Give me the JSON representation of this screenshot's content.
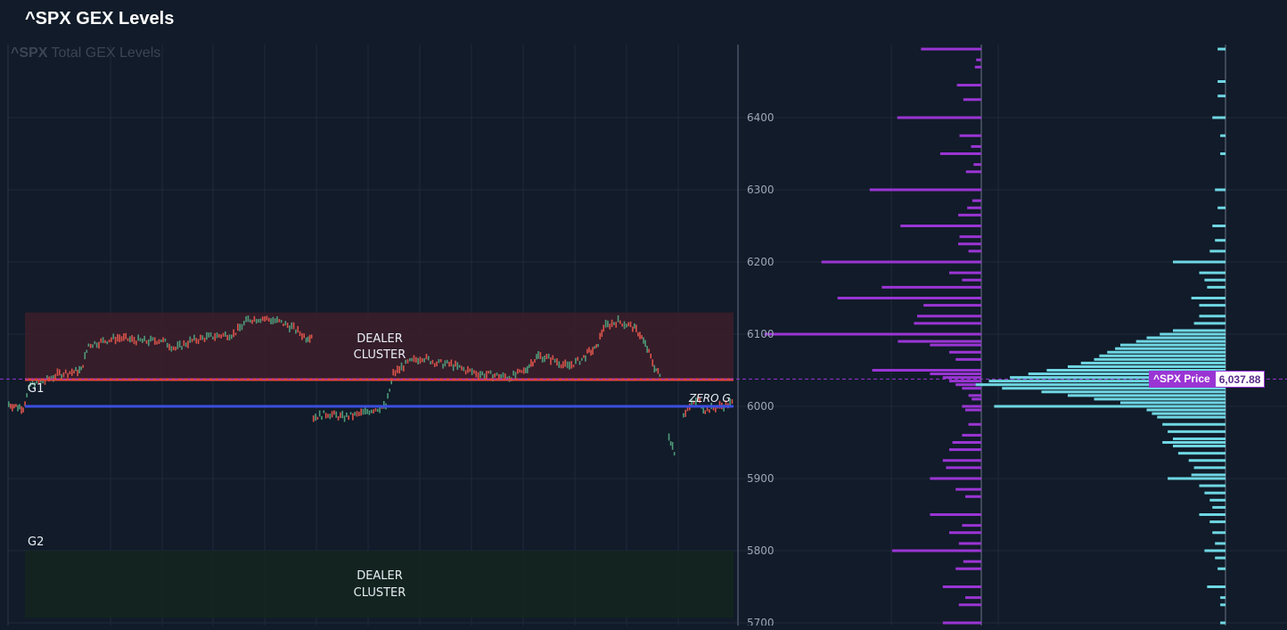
{
  "header": {
    "title": "^SPX GEX Levels"
  },
  "chart_title": {
    "ticker": "^SPX",
    "rest": "Total GEX Levels"
  },
  "colors": {
    "background": "#111b29",
    "grid": "#1f2a3a",
    "resistance_zone": "#3a1e2a",
    "support_zone": "#14261f",
    "g1_line": "#e2463c",
    "zero_gamma_line": "#3b4ee0",
    "candle_up": "#4e9a79",
    "candle_down": "#d9534a",
    "negative_gex": "#9a35d4",
    "positive_gex": "#6fd7e3",
    "price_marker": "#9a35d4"
  },
  "labels": {
    "g1": "G1",
    "g2": "G2",
    "zero_gamma": "ZERO G",
    "upper_cluster_line1": "DEALER",
    "upper_cluster_line2": "CLUSTER",
    "lower_cluster_line1": "DEALER",
    "lower_cluster_line2": "CLUSTER",
    "price_label": "^SPX Price",
    "price_value": "6,037.88"
  },
  "chart_data": {
    "type": "bar",
    "title": "^SPX Total GEX Levels",
    "ylim": [
      5700,
      6500
    ],
    "y_ticks": [
      5700,
      5800,
      5900,
      6000,
      6100,
      6200,
      6300,
      6400
    ],
    "levels": {
      "g1": 6037,
      "zero_gamma": 6000,
      "current_price": 6037.88
    },
    "zones": [
      {
        "name": "upper dealer cluster",
        "from": 6037,
        "to": 6130
      },
      {
        "name": "lower dealer cluster",
        "from": 5707,
        "to": 5800
      }
    ],
    "price_path": [
      [
        0.0,
        6003
      ],
      [
        0.01,
        6000
      ],
      [
        0.02,
        5998
      ],
      [
        0.03,
        6030
      ],
      [
        0.05,
        6035
      ],
      [
        0.07,
        6045
      ],
      [
        0.09,
        6048
      ],
      [
        0.1,
        6050
      ],
      [
        0.11,
        6085
      ],
      [
        0.13,
        6090
      ],
      [
        0.15,
        6095
      ],
      [
        0.17,
        6092
      ],
      [
        0.19,
        6090
      ],
      [
        0.21,
        6092
      ],
      [
        0.23,
        6080
      ],
      [
        0.25,
        6090
      ],
      [
        0.27,
        6095
      ],
      [
        0.29,
        6098
      ],
      [
        0.31,
        6100
      ],
      [
        0.33,
        6120
      ],
      [
        0.35,
        6122
      ],
      [
        0.37,
        6118
      ],
      [
        0.39,
        6110
      ],
      [
        0.41,
        6095
      ],
      [
        0.42,
        6100
      ],
      [
        null,
        null
      ],
      [
        0.42,
        5985
      ],
      [
        0.44,
        5990
      ],
      [
        0.46,
        5985
      ],
      [
        0.48,
        5988
      ],
      [
        0.5,
        5995
      ],
      [
        0.52,
        6000
      ],
      [
        0.53,
        6045
      ],
      [
        0.55,
        6060
      ],
      [
        0.57,
        6068
      ],
      [
        0.59,
        6060
      ],
      [
        0.61,
        6058
      ],
      [
        0.63,
        6050
      ],
      [
        0.65,
        6045
      ],
      [
        0.67,
        6043
      ],
      [
        0.69,
        6040
      ],
      [
        0.71,
        6048
      ],
      [
        0.72,
        6060
      ],
      [
        0.73,
        6070
      ],
      [
        0.75,
        6065
      ],
      [
        0.77,
        6055
      ],
      [
        0.79,
        6065
      ],
      [
        0.8,
        6075
      ],
      [
        0.81,
        6080
      ],
      [
        0.82,
        6110
      ],
      [
        0.84,
        6118
      ],
      [
        0.86,
        6110
      ],
      [
        0.87,
        6100
      ],
      [
        0.88,
        6080
      ],
      [
        0.89,
        6055
      ],
      [
        0.9,
        6038
      ],
      [
        null,
        null
      ],
      [
        0.91,
        5960
      ],
      [
        0.92,
        5930
      ],
      [
        null,
        null
      ],
      [
        0.93,
        5990
      ],
      [
        0.95,
        6010
      ],
      [
        0.96,
        5995
      ],
      [
        0.98,
        6000
      ],
      [
        1.0,
        6005
      ]
    ],
    "gex_by_strike": {
      "note_units": "relative magnitude, negative = put (purple), positive = call (cyan)",
      "series": [
        {
          "name": "negative",
          "values": [
            [
              6495,
              -0.94
            ],
            [
              6480,
              -0.08
            ],
            [
              6470,
              -0.1
            ],
            [
              6445,
              -0.38
            ],
            [
              6425,
              -0.28
            ],
            [
              6400,
              -1.31
            ],
            [
              6375,
              -0.34
            ],
            [
              6360,
              -0.16
            ],
            [
              6350,
              -0.64
            ],
            [
              6335,
              -0.12
            ],
            [
              6325,
              -0.24
            ],
            [
              6300,
              -1.74
            ],
            [
              6285,
              -0.14
            ],
            [
              6275,
              -0.22
            ],
            [
              6265,
              -0.36
            ],
            [
              6250,
              -1.26
            ],
            [
              6235,
              -0.34
            ],
            [
              6225,
              -0.36
            ],
            [
              6215,
              -0.2
            ],
            [
              6200,
              -2.49
            ],
            [
              6185,
              -0.5
            ],
            [
              6175,
              -0.3
            ],
            [
              6165,
              -1.55
            ],
            [
              6150,
              -2.24
            ],
            [
              6140,
              -0.9
            ],
            [
              6125,
              -1.0
            ],
            [
              6115,
              -1.05
            ],
            [
              6100,
              -3.38
            ],
            [
              6090,
              -1.3
            ],
            [
              6085,
              -0.8
            ],
            [
              6075,
              -0.5
            ],
            [
              6065,
              -0.4
            ],
            [
              6050,
              -1.7
            ],
            [
              6045,
              -0.8
            ],
            [
              6040,
              -0.6
            ],
            [
              6035,
              -0.5
            ],
            [
              6030,
              -0.4
            ],
            [
              6025,
              -0.3
            ],
            [
              6015,
              -0.2
            ],
            [
              6010,
              -0.15
            ],
            [
              6000,
              -0.3
            ],
            [
              5995,
              -0.25
            ],
            [
              5975,
              -0.2
            ],
            [
              5960,
              -0.3
            ],
            [
              5950,
              -0.45
            ],
            [
              5940,
              -0.5
            ],
            [
              5925,
              -0.6
            ],
            [
              5915,
              -0.55
            ],
            [
              5900,
              -0.8
            ],
            [
              5885,
              -0.4
            ],
            [
              5875,
              -0.25
            ],
            [
              5850,
              -0.8
            ],
            [
              5835,
              -0.3
            ],
            [
              5825,
              -0.5
            ],
            [
              5810,
              -0.35
            ],
            [
              5800,
              -1.39
            ],
            [
              5785,
              -0.28
            ],
            [
              5775,
              -0.4
            ],
            [
              5750,
              -0.6
            ],
            [
              5735,
              -0.25
            ],
            [
              5725,
              -0.35
            ],
            [
              5700,
              -0.6
            ]
          ]
        },
        {
          "name": "positive",
          "values": [
            [
              6495,
              0.03
            ],
            [
              6450,
              0.03
            ],
            [
              6430,
              0.03
            ],
            [
              6400,
              0.05
            ],
            [
              6375,
              0.02
            ],
            [
              6350,
              0.02
            ],
            [
              6300,
              0.04
            ],
            [
              6275,
              0.03
            ],
            [
              6250,
              0.05
            ],
            [
              6230,
              0.04
            ],
            [
              6215,
              0.06
            ],
            [
              6200,
              0.2
            ],
            [
              6185,
              0.1
            ],
            [
              6175,
              0.08
            ],
            [
              6165,
              0.07
            ],
            [
              6150,
              0.13
            ],
            [
              6140,
              0.1
            ],
            [
              6125,
              0.1
            ],
            [
              6115,
              0.12
            ],
            [
              6105,
              0.2
            ],
            [
              6100,
              0.25
            ],
            [
              6095,
              0.3
            ],
            [
              6090,
              0.34
            ],
            [
              6085,
              0.4
            ],
            [
              6080,
              0.42
            ],
            [
              6075,
              0.45
            ],
            [
              6070,
              0.48
            ],
            [
              6065,
              0.5
            ],
            [
              6060,
              0.55
            ],
            [
              6055,
              0.6
            ],
            [
              6050,
              0.68
            ],
            [
              6045,
              0.75
            ],
            [
              6040,
              0.82
            ],
            [
              6035,
              0.9
            ],
            [
              6030,
              0.95
            ],
            [
              6025,
              0.85
            ],
            [
              6020,
              0.7
            ],
            [
              6015,
              0.6
            ],
            [
              6010,
              0.5
            ],
            [
              6005,
              0.4
            ],
            [
              6000,
              0.88
            ],
            [
              5995,
              0.3
            ],
            [
              5990,
              0.28
            ],
            [
              5985,
              0.26
            ],
            [
              5975,
              0.24
            ],
            [
              5965,
              0.22
            ],
            [
              5955,
              0.2
            ],
            [
              5950,
              0.24
            ],
            [
              5945,
              0.2
            ],
            [
              5935,
              0.18
            ],
            [
              5925,
              0.14
            ],
            [
              5915,
              0.12
            ],
            [
              5905,
              0.13
            ],
            [
              5900,
              0.22
            ],
            [
              5890,
              0.1
            ],
            [
              5880,
              0.08
            ],
            [
              5870,
              0.06
            ],
            [
              5860,
              0.05
            ],
            [
              5850,
              0.1
            ],
            [
              5840,
              0.06
            ],
            [
              5825,
              0.05
            ],
            [
              5810,
              0.04
            ],
            [
              5800,
              0.08
            ],
            [
              5790,
              0.04
            ],
            [
              5775,
              0.03
            ],
            [
              5750,
              0.07
            ],
            [
              5735,
              0.02
            ],
            [
              5725,
              0.02
            ],
            [
              5700,
              0.02
            ]
          ]
        }
      ]
    }
  }
}
